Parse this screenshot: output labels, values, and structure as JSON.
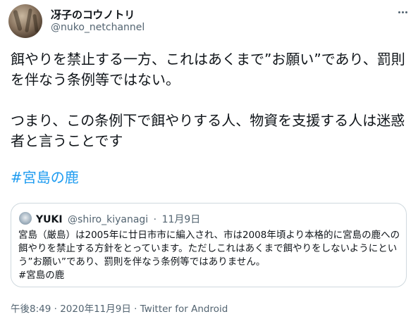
{
  "author": {
    "display_name": "冴子のコウノトリ",
    "handle": "@nuko_netchannel"
  },
  "tweet": {
    "paragraph1": "餌やりを禁止する一方、これはあくまで”お願い”であり、罰則を伴なう条例等ではない。",
    "paragraph2": "つまり、この条例下で餌やりする人、物資を支援する人は迷惑者と言うことです",
    "hashtag": "#宮島の鹿"
  },
  "quoted_tweet": {
    "display_name": "YUKI",
    "handle": "@shiro_kiyanagi",
    "separator": "·",
    "date": "11月9日",
    "text": "宮島（厳島）は2005年に廿日市市に編入され、市は2008年頃より本格的に宮島の鹿への餌やりを禁止する方針をとっています。ただしこれはあくまで餌やりをしないようにという”お願い”であり、罰則を伴なう条例等ではありません。",
    "hashtag": "#宮島の鹿"
  },
  "meta": {
    "time": "午後8:49",
    "separator": "·",
    "date": "2020年11月9日",
    "source": "Twitter for Android"
  },
  "icons": {
    "more": "more-horizontal-icon",
    "avatar": "user-avatar",
    "quoted_avatar": "quoted-user-avatar"
  },
  "colors": {
    "text": "#0f1419",
    "secondary": "#536471",
    "link": "#1d9bf0",
    "border": "#cfd9de"
  }
}
